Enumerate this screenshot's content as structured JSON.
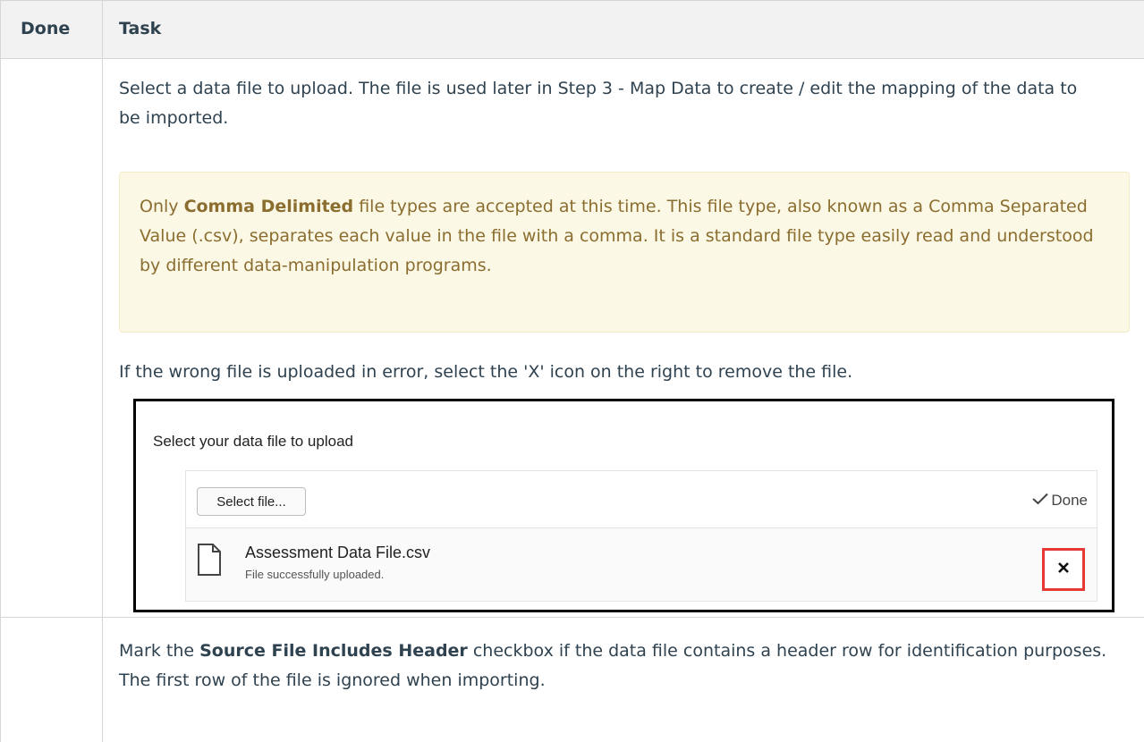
{
  "table": {
    "headers": {
      "done": "Done",
      "task": "Task"
    }
  },
  "rows": [
    {
      "intro": "Select a data file to upload. The file is used later in Step 3 - Map Data to create / edit the mapping of the data to be imported.",
      "note": {
        "prefix": "Only ",
        "bold": "Comma Delimited",
        "suffix": " file types are accepted at this time. This file type, also known as a Comma Separated Value (.csv), separates each value in the file with a comma. It is a standard file type easily read and understood by different data-manipulation programs."
      },
      "instruction": "If the wrong file is uploaded in error, select the 'X' icon on the right to remove the file.",
      "screenshot": {
        "title": "Select your data file to upload",
        "select_button": "Select file...",
        "status": "Done",
        "file_name": "Assessment Data File.csv",
        "file_status": "File successfully uploaded.",
        "remove_icon": "close-icon",
        "highlight_color": "#e53935"
      }
    },
    {
      "intro_prefix": "Mark the ",
      "intro_bold": "Source File Includes Header",
      "intro_suffix": "  checkbox if the data file contains a header row for identification purposes. The first row of the file is ignored when importing."
    }
  ],
  "colors": {
    "note_background": "#fcf8e6",
    "note_text": "#8a6d2f",
    "body_text": "#2f4250"
  }
}
